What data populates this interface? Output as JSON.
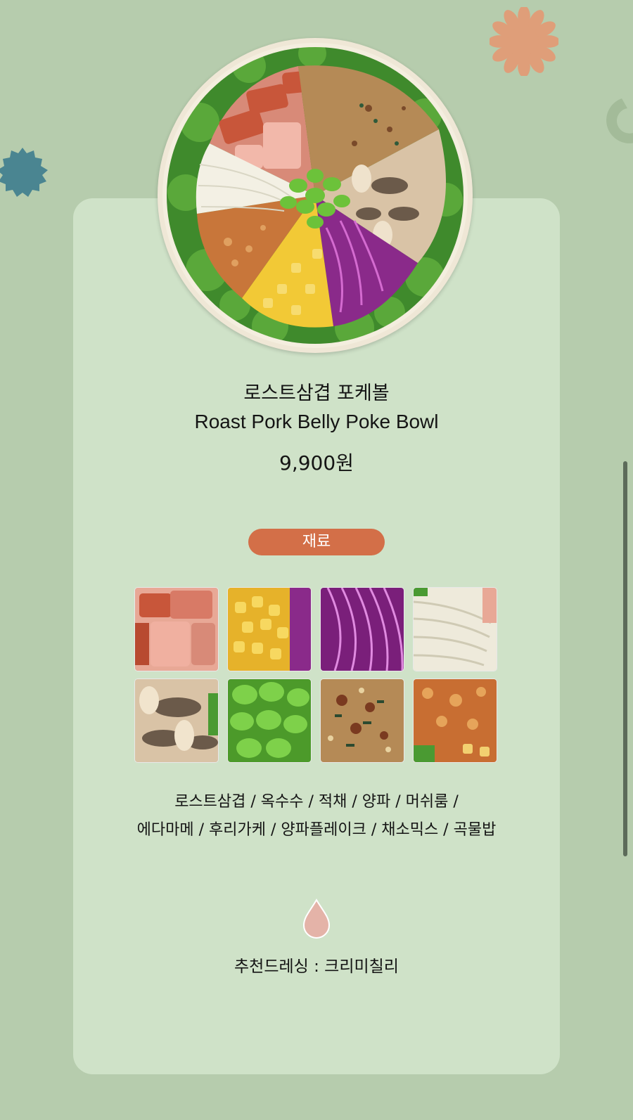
{
  "product": {
    "name_ko": "로스트삼겹 포케볼",
    "name_en": "Roast Pork Belly Poke Bowl",
    "price": "9,900원"
  },
  "ingredients_section": {
    "label": "재료",
    "line1": "로스트삼겹 / 옥수수 / 적채 / 양파 / 머쉬룸 /",
    "line2": "에다마메 / 후리가케 / 양파플레이크 / 채소믹스 / 곡물밥"
  },
  "thumbnails": [
    {
      "ingredient": "roast-pork-belly"
    },
    {
      "ingredient": "corn"
    },
    {
      "ingredient": "red-cabbage"
    },
    {
      "ingredient": "onion"
    },
    {
      "ingredient": "mushroom"
    },
    {
      "ingredient": "edamame"
    },
    {
      "ingredient": "furikake"
    },
    {
      "ingredient": "fried-onion-flakes"
    }
  ],
  "dressing": {
    "text": "추천드레싱 : 크리미칠리",
    "icon": "dressing-drop-icon"
  },
  "colors": {
    "background": "#b6ccad",
    "card": "#cfe2c8",
    "accent_pill": "#d36f48",
    "drop": "#e4b3a8",
    "flower_orange": "#df9e79",
    "flower_teal": "#4a8591"
  }
}
